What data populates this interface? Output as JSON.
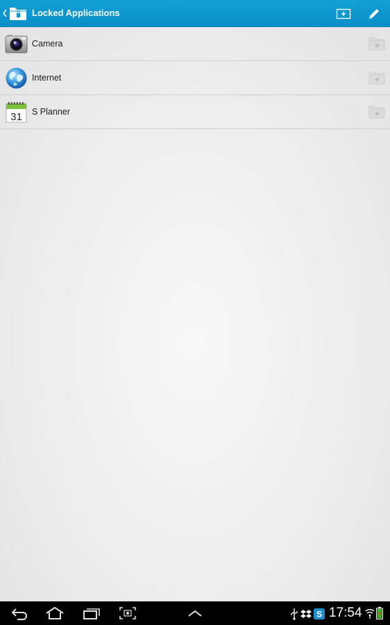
{
  "action_bar": {
    "title": "Locked Applications",
    "app_icon": "lock-folder-icon",
    "actions": [
      {
        "name": "add",
        "icon": "add-window-icon"
      },
      {
        "name": "edit",
        "icon": "pencil-icon"
      }
    ],
    "color": "#0f98d0"
  },
  "apps": [
    {
      "label": "Camera",
      "icon": "camera-app-icon"
    },
    {
      "label": "Internet",
      "icon": "globe-app-icon"
    },
    {
      "label": "S Planner",
      "icon": "calendar-app-icon",
      "icon_text": "31"
    }
  ],
  "status_bar": {
    "time": "17:54",
    "icons": [
      "usb-icon",
      "dropbox-icon",
      "skype-icon",
      "wifi-icon",
      "battery-icon"
    ]
  },
  "nav_bar": {
    "buttons": [
      "back-icon",
      "home-icon",
      "recent-apps-icon",
      "screenshot-icon",
      "chevron-up-icon"
    ]
  }
}
